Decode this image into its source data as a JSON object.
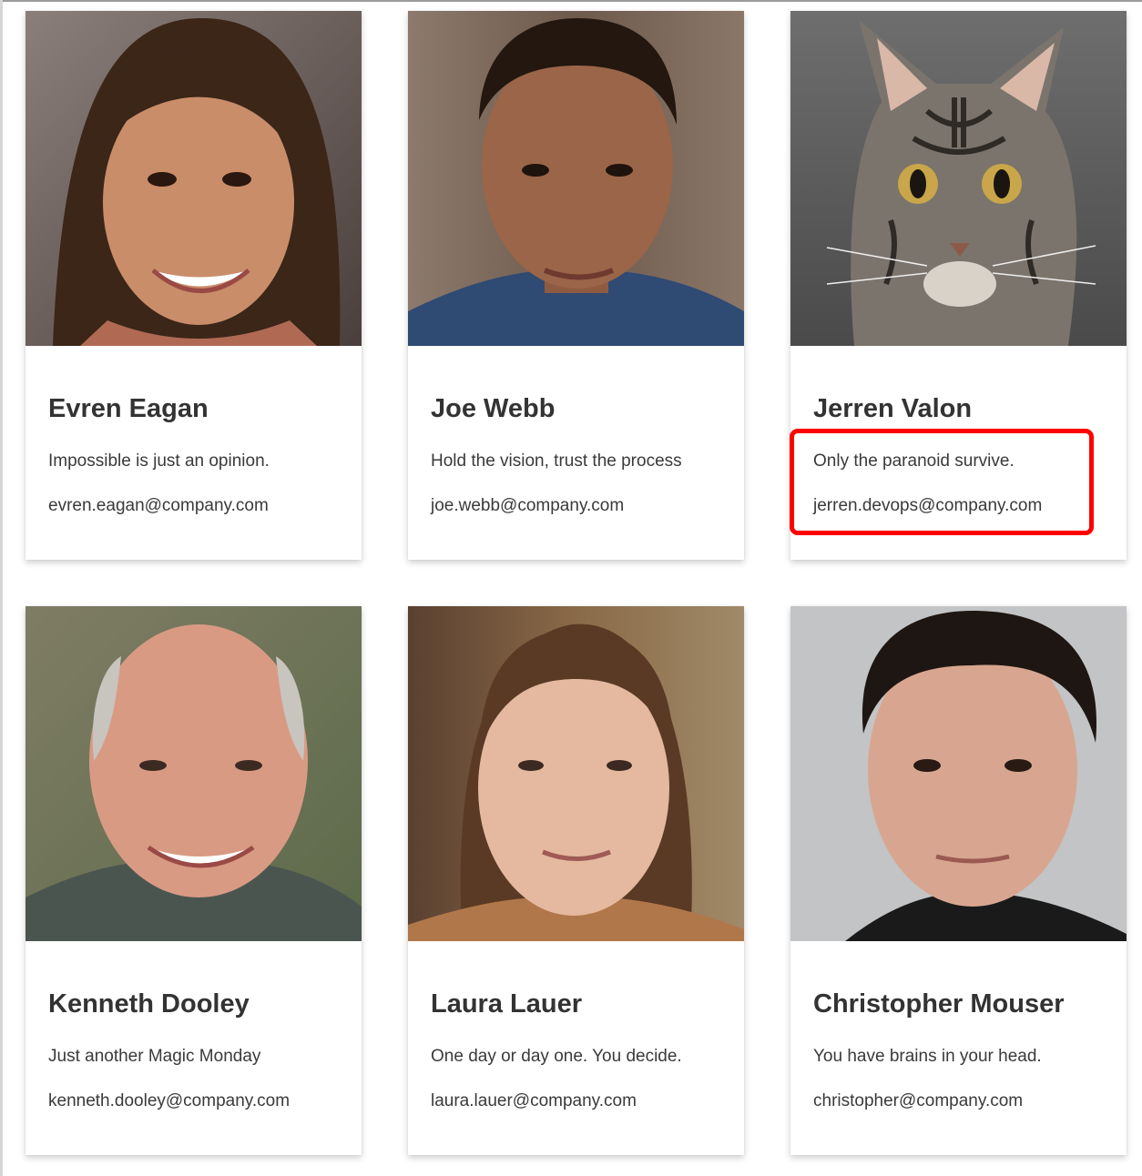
{
  "team": {
    "members": [
      {
        "name": "Evren Eagan",
        "quote": "Impossible is just an opinion.",
        "email": "evren.eagan@company.com"
      },
      {
        "name": "Joe Webb",
        "quote": "Hold the vision, trust the process",
        "email": "joe.webb@company.com"
      },
      {
        "name": "Jerren Valon",
        "quote": "Only the paranoid survive.",
        "email": "jerren.devops@company.com"
      },
      {
        "name": "Kenneth Dooley",
        "quote": "Just another Magic Monday",
        "email": "kenneth.dooley@company.com"
      },
      {
        "name": "Laura Lauer",
        "quote": "One day or day one. You decide.",
        "email": "laura.lauer@company.com"
      },
      {
        "name": "Christopher Mouser",
        "quote": "You have brains in your head.",
        "email": "christopher@company.com"
      }
    ]
  },
  "colors": {
    "card_background": "#ffffff",
    "name_text": "#333333",
    "body_text": "#3a3a3a",
    "highlight_outline": "#ff0000"
  }
}
